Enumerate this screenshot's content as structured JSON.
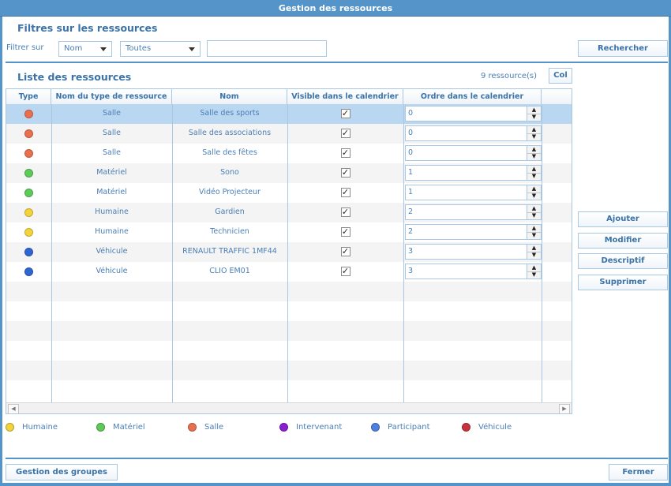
{
  "window": {
    "title": "Gestion des ressources"
  },
  "filters": {
    "section_title": "Filtres sur les ressources",
    "label": "Filtrer sur",
    "field_select": "Nom",
    "type_select": "Toutes",
    "search_value": "",
    "search_button": "Rechercher"
  },
  "list": {
    "section_title": "Liste des ressources",
    "count": "9 ressource(s)",
    "col_button": "Col",
    "columns": [
      "Type",
      "Nom du type de ressource",
      "Nom",
      "Visible dans le calendrier",
      "Ordre dans le calendrier"
    ],
    "rows": [
      {
        "color": "#e8704f",
        "type_name": "Salle",
        "name": "Salle des sports",
        "visible": true,
        "order": "0"
      },
      {
        "color": "#e8704f",
        "type_name": "Salle",
        "name": "Salle des associations",
        "visible": true,
        "order": "0"
      },
      {
        "color": "#e8704f",
        "type_name": "Salle",
        "name": "Salle des fêtes",
        "visible": true,
        "order": "0"
      },
      {
        "color": "#5fc95a",
        "type_name": "Matériel",
        "name": "Sono",
        "visible": true,
        "order": "1"
      },
      {
        "color": "#5fc95a",
        "type_name": "Matériel",
        "name": "Vidéo Projecteur",
        "visible": true,
        "order": "1"
      },
      {
        "color": "#f2d43a",
        "type_name": "Humaine",
        "name": "Gardien",
        "visible": true,
        "order": "2"
      },
      {
        "color": "#f2d43a",
        "type_name": "Humaine",
        "name": "Technicien",
        "visible": true,
        "order": "2"
      },
      {
        "color": "#2f65d1",
        "type_name": "Véhicule",
        "name": "RENAULT TRAFFIC 1MF44",
        "visible": true,
        "order": "3"
      },
      {
        "color": "#2f65d1",
        "type_name": "Véhicule",
        "name": "CLIO EM01",
        "visible": true,
        "order": "3"
      }
    ],
    "selected_row": 0
  },
  "actions": {
    "add": "Ajouter",
    "edit": "Modifier",
    "describe": "Descriptif",
    "delete": "Supprimer"
  },
  "legend": [
    {
      "label": "Humaine",
      "color": "#f2d43a"
    },
    {
      "label": "Matériel",
      "color": "#5fc95a"
    },
    {
      "label": "Salle",
      "color": "#e8704f"
    },
    {
      "label": "Intervenant",
      "color": "#8a1fd0"
    },
    {
      "label": "Participant",
      "color": "#4f7fe0"
    },
    {
      "label": "Véhicule",
      "color": "#c8323a"
    }
  ],
  "footer": {
    "groups_button": "Gestion des groupes",
    "close_button": "Fermer"
  }
}
